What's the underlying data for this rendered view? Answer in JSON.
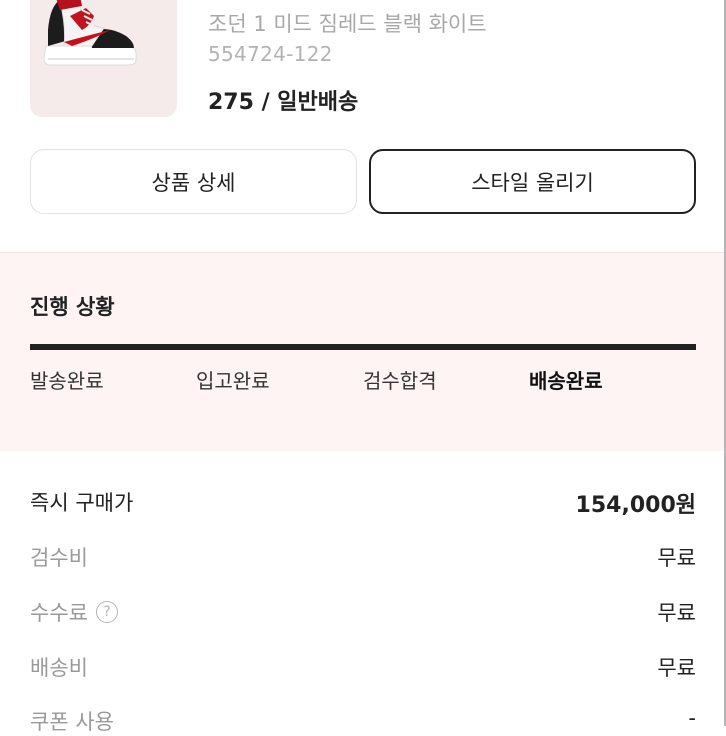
{
  "product": {
    "name": "조던 1 미드 짐레드 블랙 화이트",
    "model": "554724-122",
    "size_shipping": "275 / 일반배송",
    "image_icon": "sneaker-image"
  },
  "actions": {
    "detail_label": "상품 상세",
    "style_label": "스타일 올리기"
  },
  "progress": {
    "title": "진행 상황",
    "steps": [
      "발송완료",
      "입고완료",
      "검수합격",
      "배송완료"
    ],
    "current_step": 4
  },
  "price": {
    "rows": [
      {
        "label": "즉시 구매가",
        "value": "154,000원"
      },
      {
        "label": "검수비",
        "value": "무료"
      },
      {
        "label": "수수료",
        "value": "무료",
        "icon": "question-circle-icon",
        "icon_glyph": "?"
      },
      {
        "label": "배송비",
        "value": "무료"
      },
      {
        "label": "쿠폰 사용",
        "value": "-"
      }
    ]
  }
}
